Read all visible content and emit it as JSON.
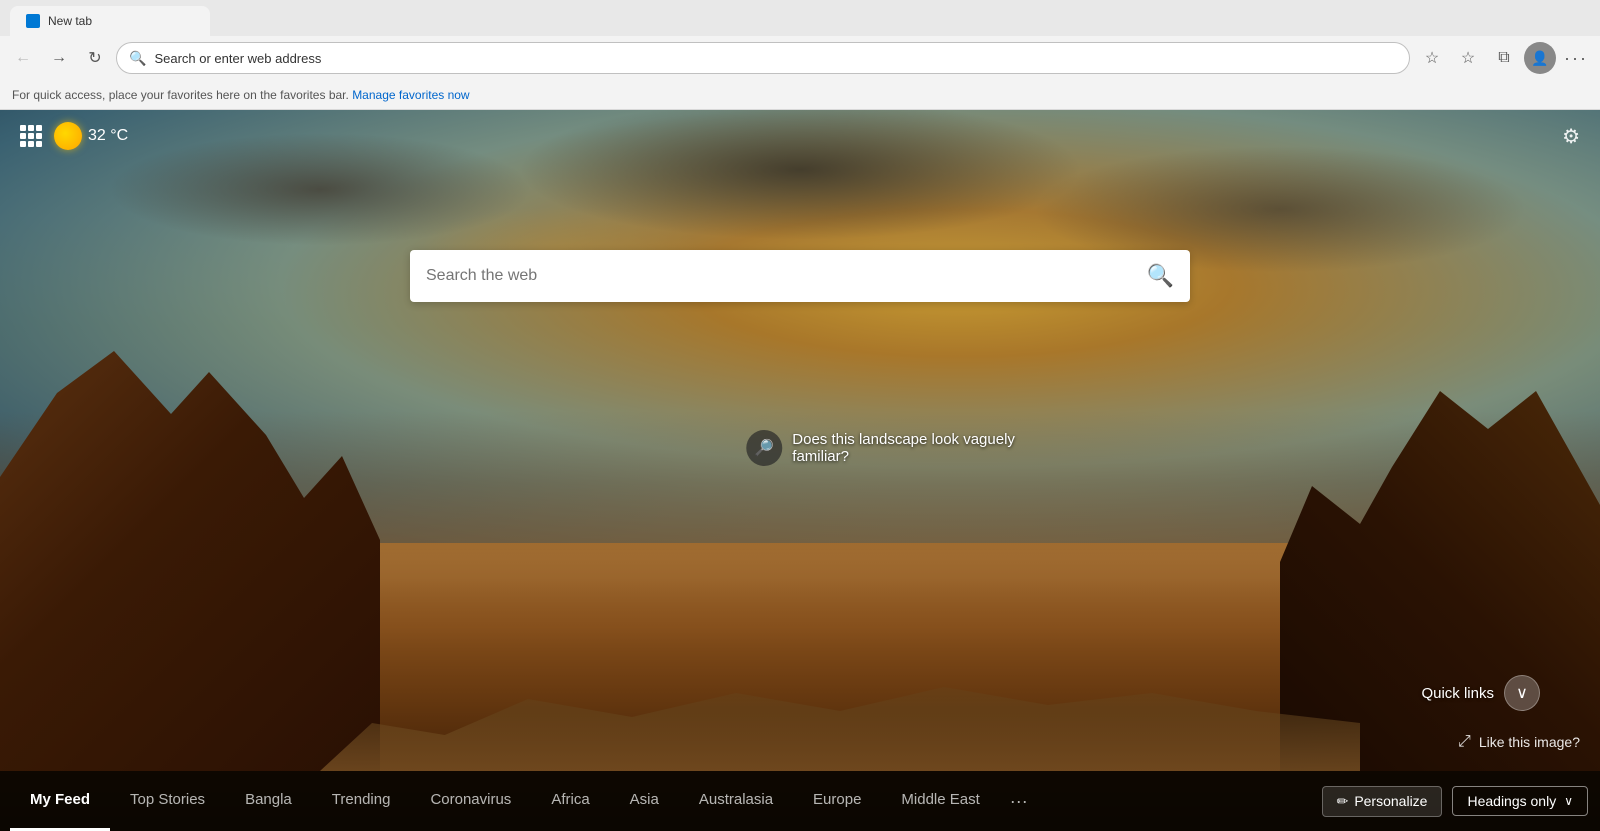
{
  "browser": {
    "tab_title": "New tab",
    "address_bar": {
      "text": "Search or enter web address",
      "placeholder": "Search or enter web address"
    },
    "favorites_bar": {
      "prompt_text": "For quick access, place your favorites here on the favorites bar.",
      "manage_link": "Manage favorites now"
    }
  },
  "new_tab": {
    "weather": {
      "temperature": "32",
      "unit": "°C"
    },
    "search": {
      "placeholder": "Search the web"
    },
    "image_info": {
      "text_line1": "Does this landscape look vaguely",
      "text_line2": "familiar?"
    },
    "quick_links": {
      "label": "Quick links",
      "chevron": "❯"
    },
    "like_image": {
      "text": "Like this image?"
    },
    "bottom_nav": {
      "tabs": [
        {
          "id": "my-feed",
          "label": "My Feed",
          "active": true
        },
        {
          "id": "top-stories",
          "label": "Top Stories",
          "active": false
        },
        {
          "id": "bangla",
          "label": "Bangla",
          "active": false
        },
        {
          "id": "trending",
          "label": "Trending",
          "active": false
        },
        {
          "id": "coronavirus",
          "label": "Coronavirus",
          "active": false
        },
        {
          "id": "africa",
          "label": "Africa",
          "active": false
        },
        {
          "id": "asia",
          "label": "Asia",
          "active": false
        },
        {
          "id": "australasia",
          "label": "Australasia",
          "active": false
        },
        {
          "id": "europe",
          "label": "Europe",
          "active": false
        },
        {
          "id": "middle-east",
          "label": "Middle East",
          "active": false
        }
      ],
      "more_label": "···",
      "personalize_label": "Personalize",
      "headings_only_label": "Headings only"
    }
  },
  "icons": {
    "back": "←",
    "forward": "→",
    "refresh": "↻",
    "search_address": "🔍",
    "add_favorite": "☆",
    "favorites": "☆",
    "collections": "⧉",
    "profile": "👤",
    "more": "···",
    "settings_gear": "⚙",
    "search_web": "🔍",
    "image_search": "🔎",
    "expand": "⤢",
    "pencil": "✏"
  }
}
